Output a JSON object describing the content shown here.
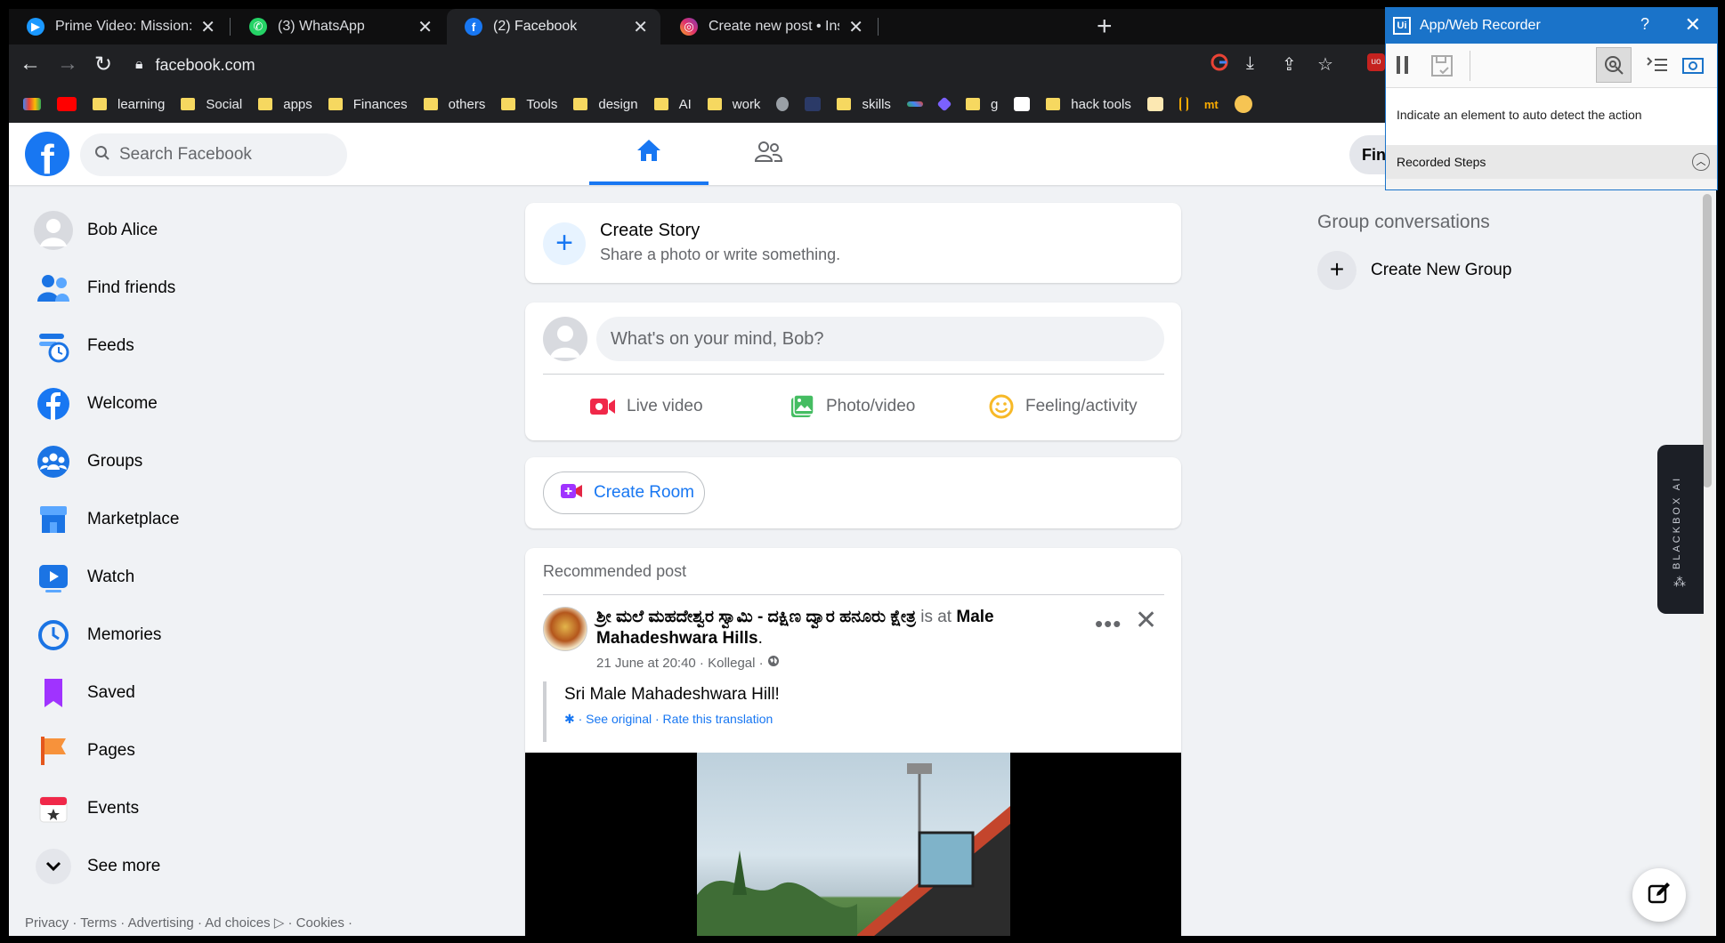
{
  "browser": {
    "tabs": [
      {
        "title": "Prime Video: Mission: Impossible",
        "favicon": "prime-video-icon"
      },
      {
        "title": "(3) WhatsApp",
        "favicon": "whatsapp-icon"
      },
      {
        "title": "(2) Facebook",
        "favicon": "facebook-icon",
        "active": true
      },
      {
        "title": "Create new post • Instagram",
        "favicon": "instagram-icon"
      }
    ],
    "url": "facebook.com",
    "bookmarks": [
      "learning",
      "Social",
      "apps",
      "Finances",
      "others",
      "Tools",
      "design",
      "AI",
      "work",
      "skills",
      "g",
      "hack tools"
    ],
    "bookmark_short": "mt"
  },
  "fb": {
    "search_placeholder": "Search Facebook",
    "find_button": "Fin",
    "left_nav": [
      {
        "label": "Bob Alice",
        "icon": "avatar"
      },
      {
        "label": "Find friends",
        "icon": "friends-icon"
      },
      {
        "label": "Feeds",
        "icon": "feeds-icon"
      },
      {
        "label": "Welcome",
        "icon": "facebook-icon"
      },
      {
        "label": "Groups",
        "icon": "groups-icon"
      },
      {
        "label": "Marketplace",
        "icon": "marketplace-icon"
      },
      {
        "label": "Watch",
        "icon": "watch-icon"
      },
      {
        "label": "Memories",
        "icon": "memories-icon"
      },
      {
        "label": "Saved",
        "icon": "saved-icon"
      },
      {
        "label": "Pages",
        "icon": "pages-icon"
      },
      {
        "label": "Events",
        "icon": "events-icon"
      },
      {
        "label": "See more",
        "icon": "chevron-down-icon"
      }
    ],
    "footer": "Privacy · Terms · Advertising · Ad choices ▷ · Cookies ·",
    "story": {
      "title": "Create Story",
      "subtitle": "Share a photo or write something."
    },
    "composer": {
      "placeholder": "What's on your mind, Bob?",
      "actions": [
        "Live video",
        "Photo/video",
        "Feeling/activity"
      ]
    },
    "room_label": "Create Room",
    "post": {
      "header": "Recommended post",
      "author": "ಶ್ರೀ ಮಲೆ ಮಹದೇಶ್ವರ ಸ್ವಾಮಿ - ದಕ್ಷಿಣ ದ್ವಾರ ಹನೂರು ಕ್ಷೇತ್ರ",
      "is_at": "is at",
      "place": "Male Mahadeshwara Hills",
      "meta": "21 June at 20:40 · Kollegal ·",
      "text": "Sri Male Mahadeshwara Hill!",
      "translation": "· See original · Rate this translation"
    },
    "groups": {
      "title": "Group conversations",
      "create": "Create New Group"
    }
  },
  "blackbox_label": "BLACKBOX AI",
  "recorder": {
    "title": "App/Web Recorder",
    "help": "?",
    "hint": "Indicate an element to auto detect the action",
    "steps": "Recorded Steps"
  },
  "colors": {
    "fb_blue": "#1877f2",
    "recorder_blue": "#1a73c9"
  }
}
